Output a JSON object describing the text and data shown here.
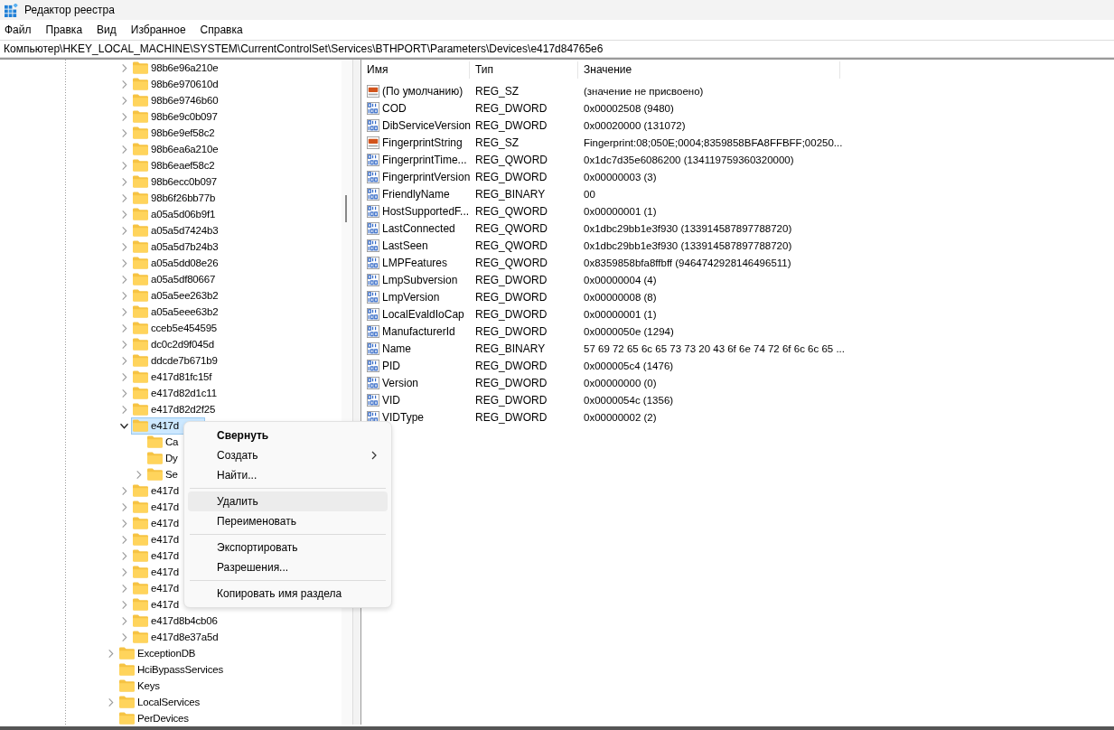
{
  "window": {
    "title": "Редактор реестра"
  },
  "menu_bar": [
    "Файл",
    "Правка",
    "Вид",
    "Избранное",
    "Справка"
  ],
  "address": "Компьютер\\HKEY_LOCAL_MACHINE\\SYSTEM\\CurrentControlSet\\Services\\BTHPORT\\Parameters\\Devices\\e417d84765e6",
  "tree": [
    {
      "children": [
        {
          "label": "98b6e96a210e",
          "expandable": true,
          "expanded": false,
          "selected": false
        },
        {
          "label": "98b6e970610d",
          "expandable": true,
          "expanded": false,
          "selected": false
        },
        {
          "label": "98b6e9746b60",
          "expandable": true,
          "expanded": false,
          "selected": false
        },
        {
          "label": "98b6e9c0b097",
          "expandable": true,
          "expanded": false,
          "selected": false
        },
        {
          "label": "98b6e9ef58c2",
          "expandable": true,
          "expanded": false,
          "selected": false
        },
        {
          "label": "98b6ea6a210e",
          "expandable": true,
          "expanded": false,
          "selected": false
        },
        {
          "label": "98b6eaef58c2",
          "expandable": true,
          "expanded": false,
          "selected": false
        },
        {
          "label": "98b6ecc0b097",
          "expandable": true,
          "expanded": false,
          "selected": false
        },
        {
          "label": "98b6f26bb77b",
          "expandable": true,
          "expanded": false,
          "selected": false
        },
        {
          "label": "a05a5d06b9f1",
          "expandable": true,
          "expanded": false,
          "selected": false
        },
        {
          "label": "a05a5d7424b3",
          "expandable": true,
          "expanded": false,
          "selected": false
        },
        {
          "label": "a05a5d7b24b3",
          "expandable": true,
          "expanded": false,
          "selected": false
        },
        {
          "label": "a05a5dd08e26",
          "expandable": true,
          "expanded": false,
          "selected": false
        },
        {
          "label": "a05a5df80667",
          "expandable": true,
          "expanded": false,
          "selected": false
        },
        {
          "label": "a05a5ee263b2",
          "expandable": true,
          "expanded": false,
          "selected": false
        },
        {
          "label": "a05a5eee63b2",
          "expandable": true,
          "expanded": false,
          "selected": false
        },
        {
          "label": "cceb5e454595",
          "expandable": true,
          "expanded": false,
          "selected": false
        },
        {
          "label": "dc0c2d9f045d",
          "expandable": true,
          "expanded": false,
          "selected": false
        },
        {
          "label": "ddcde7b671b9",
          "expandable": true,
          "expanded": false,
          "selected": false
        },
        {
          "label": "e417d81fc15f",
          "expandable": true,
          "expanded": false,
          "selected": false
        },
        {
          "label": "e417d82d1c11",
          "expandable": true,
          "expanded": false,
          "selected": false
        },
        {
          "label": "e417d82d2f25",
          "expandable": true,
          "expanded": false,
          "selected": false
        },
        {
          "label": "e417d",
          "expandable": true,
          "expanded": true,
          "selected": true,
          "children": [
            {
              "label": "Ca",
              "expandable": false,
              "selected": false
            },
            {
              "label": "Dy",
              "expandable": false,
              "selected": false
            },
            {
              "label": "Se",
              "expandable": true,
              "expanded": false,
              "selected": false
            }
          ]
        },
        {
          "label": "e417d",
          "expandable": true,
          "expanded": false,
          "selected": false
        },
        {
          "label": "e417d",
          "expandable": true,
          "expanded": false,
          "selected": false
        },
        {
          "label": "e417d",
          "expandable": true,
          "expanded": false,
          "selected": false
        },
        {
          "label": "e417d",
          "expandable": true,
          "expanded": false,
          "selected": false
        },
        {
          "label": "e417d",
          "expandable": true,
          "expanded": false,
          "selected": false
        },
        {
          "label": "e417d",
          "expandable": true,
          "expanded": false,
          "selected": false
        },
        {
          "label": "e417d",
          "expandable": true,
          "expanded": false,
          "selected": false
        },
        {
          "label": "e417d",
          "expandable": true,
          "expanded": false,
          "selected": false
        },
        {
          "label": "e417d8b4cb06",
          "expandable": true,
          "expanded": false,
          "selected": false
        },
        {
          "label": "e417d8e37a5d",
          "expandable": true,
          "expanded": false,
          "selected": false
        }
      ]
    },
    {
      "label": "ExceptionDB",
      "expandable": true,
      "expanded": false,
      "selected": false
    },
    {
      "label": "HciBypassServices",
      "expandable": false,
      "selected": false
    },
    {
      "label": "Keys",
      "expandable": false,
      "selected": false
    },
    {
      "label": "LocalServices",
      "expandable": true,
      "expanded": false,
      "selected": false
    },
    {
      "label": "PerDevices",
      "expandable": false,
      "selected": false
    }
  ],
  "values": {
    "columns": [
      "Имя",
      "Тип",
      "Значение"
    ],
    "rows": [
      {
        "kind": "string",
        "name": "(По умолчанию)",
        "type": "REG_SZ",
        "data": "(значение не присвоено)"
      },
      {
        "kind": "binary",
        "name": "COD",
        "type": "REG_DWORD",
        "data": "0x00002508 (9480)"
      },
      {
        "kind": "binary",
        "name": "DibServiceVersion",
        "type": "REG_DWORD",
        "data": "0x00020000 (131072)"
      },
      {
        "kind": "string",
        "name": "FingerprintString",
        "type": "REG_SZ",
        "data": "Fingerprint:08;050E;0004;8359858BFA8FFBFF;00250..."
      },
      {
        "kind": "binary",
        "name": "FingerprintTime...",
        "type": "REG_QWORD",
        "data": "0x1dc7d35e6086200 (134119759360320000)"
      },
      {
        "kind": "binary",
        "name": "FingerprintVersion",
        "type": "REG_DWORD",
        "data": "0x00000003 (3)"
      },
      {
        "kind": "binary",
        "name": "FriendlyName",
        "type": "REG_BINARY",
        "data": "00"
      },
      {
        "kind": "binary",
        "name": "HostSupportedF...",
        "type": "REG_QWORD",
        "data": "0x00000001 (1)"
      },
      {
        "kind": "binary",
        "name": "LastConnected",
        "type": "REG_QWORD",
        "data": "0x1dbc29bb1e3f930 (133914587897788720)"
      },
      {
        "kind": "binary",
        "name": "LastSeen",
        "type": "REG_QWORD",
        "data": "0x1dbc29bb1e3f930 (133914587897788720)"
      },
      {
        "kind": "binary",
        "name": "LMPFeatures",
        "type": "REG_QWORD",
        "data": "0x8359858bfa8ffbff (9464742928146496511)"
      },
      {
        "kind": "binary",
        "name": "LmpSubversion",
        "type": "REG_DWORD",
        "data": "0x00000004 (4)"
      },
      {
        "kind": "binary",
        "name": "LmpVersion",
        "type": "REG_DWORD",
        "data": "0x00000008 (8)"
      },
      {
        "kind": "binary",
        "name": "LocalEvaldIoCap",
        "type": "REG_DWORD",
        "data": "0x00000001 (1)"
      },
      {
        "kind": "binary",
        "name": "ManufacturerId",
        "type": "REG_DWORD",
        "data": "0x0000050e (1294)"
      },
      {
        "kind": "binary",
        "name": "Name",
        "type": "REG_BINARY",
        "data": "57 69 72 65 6c 65 73 73 20 43 6f 6e 74 72 6f 6c 6c 65 ..."
      },
      {
        "kind": "binary",
        "name": "PID",
        "type": "REG_DWORD",
        "data": "0x000005c4 (1476)"
      },
      {
        "kind": "binary",
        "name": "Version",
        "type": "REG_DWORD",
        "data": "0x00000000 (0)"
      },
      {
        "kind": "binary",
        "name": "VID",
        "type": "REG_DWORD",
        "data": "0x0000054c (1356)"
      },
      {
        "kind": "binary",
        "name": "VIDType",
        "type": "REG_DWORD",
        "data": "0x00000002 (2)"
      }
    ]
  },
  "context_menu": [
    {
      "kind": "item",
      "label": "Свернуть",
      "bold": true,
      "submenu": false,
      "highlighted": false
    },
    {
      "kind": "item",
      "label": "Создать",
      "bold": false,
      "submenu": true,
      "highlighted": false
    },
    {
      "kind": "item",
      "label": "Найти...",
      "bold": false,
      "submenu": false,
      "highlighted": false
    },
    {
      "kind": "separator"
    },
    {
      "kind": "item",
      "label": "Удалить",
      "bold": false,
      "submenu": false,
      "highlighted": true
    },
    {
      "kind": "item",
      "label": "Переименовать",
      "bold": false,
      "submenu": false,
      "highlighted": false
    },
    {
      "kind": "separator"
    },
    {
      "kind": "item",
      "label": "Экспортировать",
      "bold": false,
      "submenu": false,
      "highlighted": false
    },
    {
      "kind": "item",
      "label": "Разрешения...",
      "bold": false,
      "submenu": false,
      "highlighted": false
    },
    {
      "kind": "separator"
    },
    {
      "kind": "item",
      "label": "Копировать имя раздела",
      "bold": false,
      "submenu": false,
      "highlighted": false
    }
  ]
}
